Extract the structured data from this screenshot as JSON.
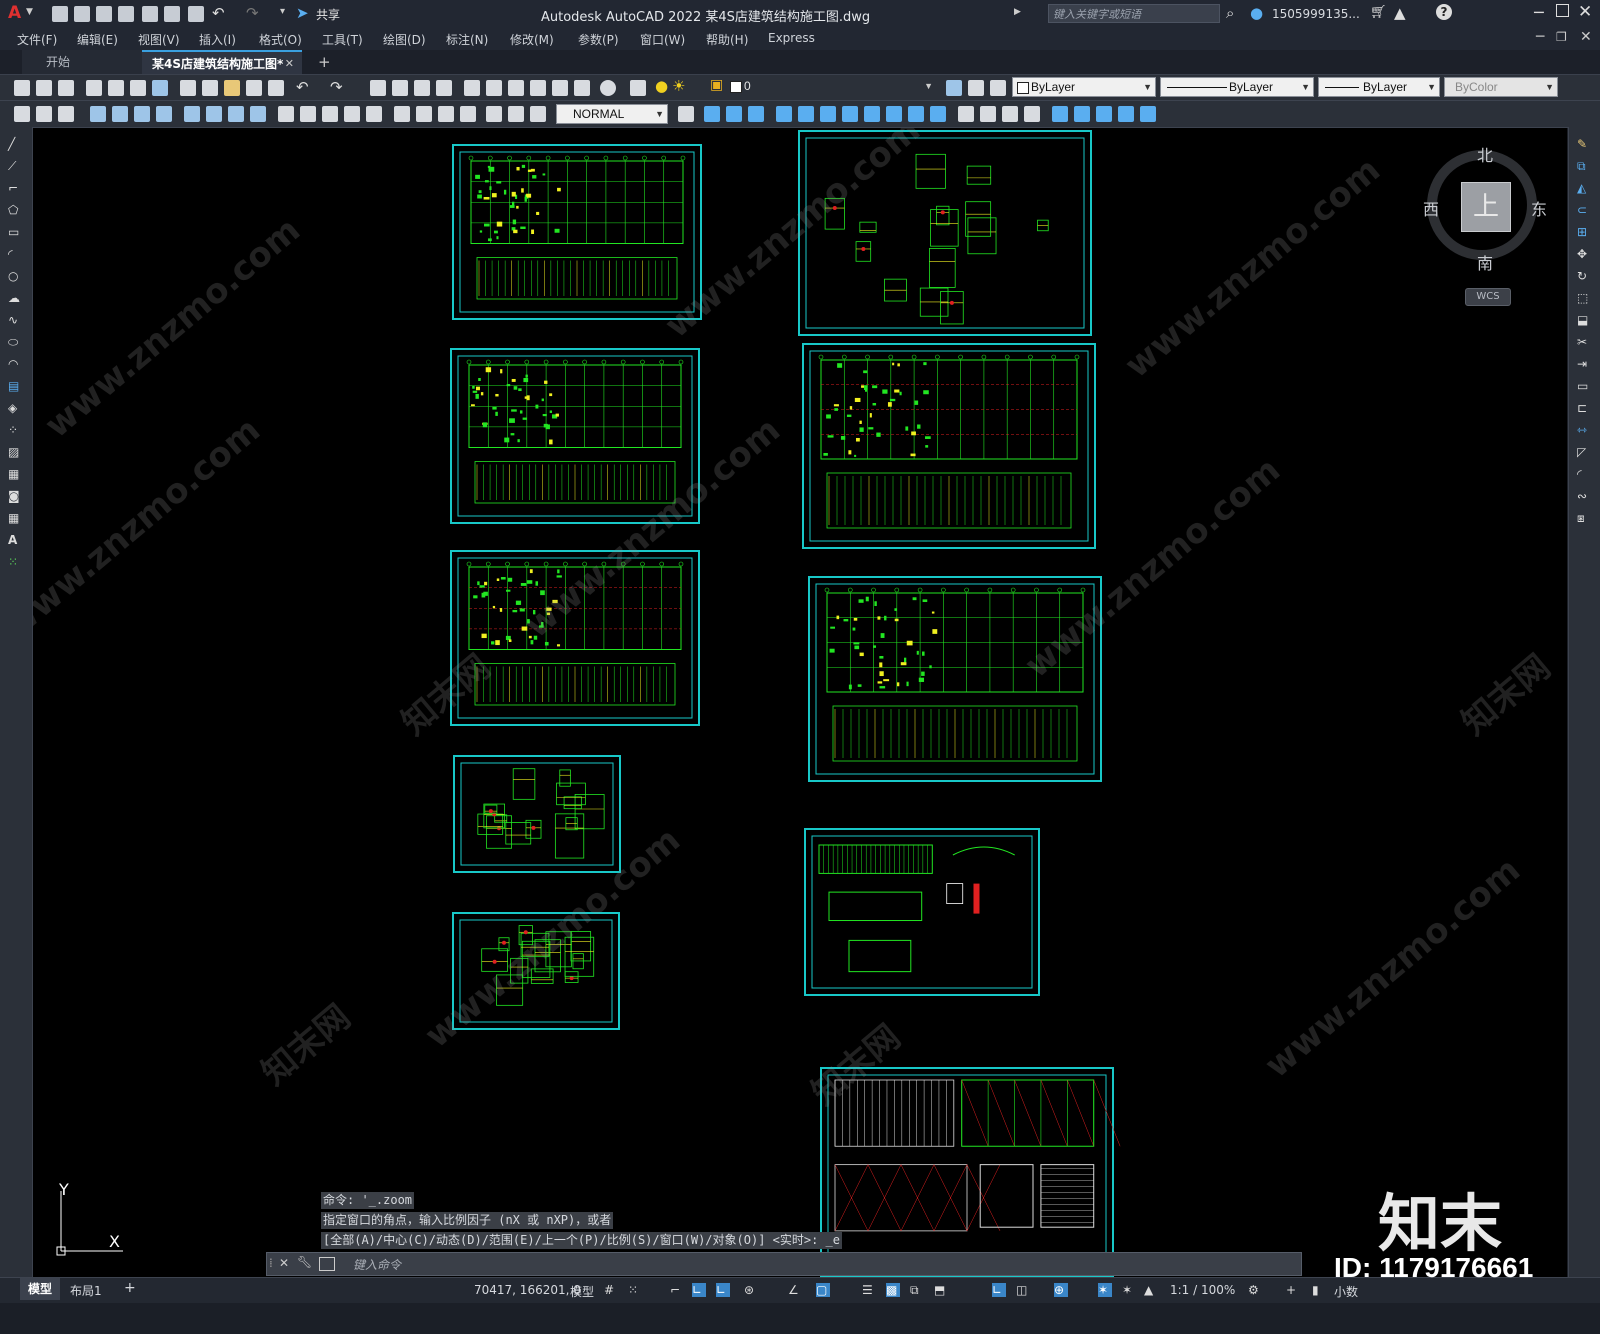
{
  "title_bar": {
    "app_title": "Autodesk AutoCAD 2022    某4S店建筑结构施工图.dwg",
    "share_label": "共享",
    "search_placeholder": "键入关键字或短语",
    "user": "1505999135...",
    "logo_letter": "A"
  },
  "menu": [
    "文件(F)",
    "编辑(E)",
    "视图(V)",
    "插入(I)",
    "格式(O)",
    "工具(T)",
    "绘图(D)",
    "标注(N)",
    "修改(M)",
    "参数(P)",
    "窗口(W)",
    "帮助(H)",
    "Express"
  ],
  "tabs": {
    "start": "开始",
    "document": "某4S店建筑结构施工图*",
    "close": "✕",
    "add": "+"
  },
  "properties": {
    "layer": "0",
    "color": "ByLayer",
    "linetype": "ByLayer",
    "lineweight": "ByLayer",
    "plotstyle": "ByColor",
    "dimstyle": "NORMAL"
  },
  "viewcube": {
    "north": "北",
    "south": "南",
    "east": "东",
    "west": "西",
    "top_face": "上",
    "wcs": "WCS"
  },
  "ucs": {
    "y": "Y",
    "x": "X"
  },
  "command": {
    "history": [
      "命令: '_.zoom",
      "指定窗口的角点，输入比例因子 (nX 或 nXP)，或者",
      "[全部(A)/中心(C)/动态(D)/范围(E)/上一个(P)/比例(S)/窗口(W)/对象(O)] <实时>: _e"
    ],
    "placeholder": "键入命令"
  },
  "status_bar": {
    "layout_tabs": [
      "模型",
      "布局1"
    ],
    "add_layout": "+",
    "coordinates": "70417, 166201, 0",
    "space": "模型",
    "scale": "1:1 / 100%",
    "units": "小数"
  },
  "watermark": {
    "brand": "知末",
    "id": "ID: 1179176661",
    "url": "www.znzmo.com",
    "site": "知末网"
  },
  "colors": {
    "sheet_border": "#18c8c8",
    "drawing_green": "#22e622",
    "drawing_yellow": "#f0f020",
    "drawing_red": "#e02020",
    "canvas": "#000000",
    "accent": "#3aa0e0"
  }
}
